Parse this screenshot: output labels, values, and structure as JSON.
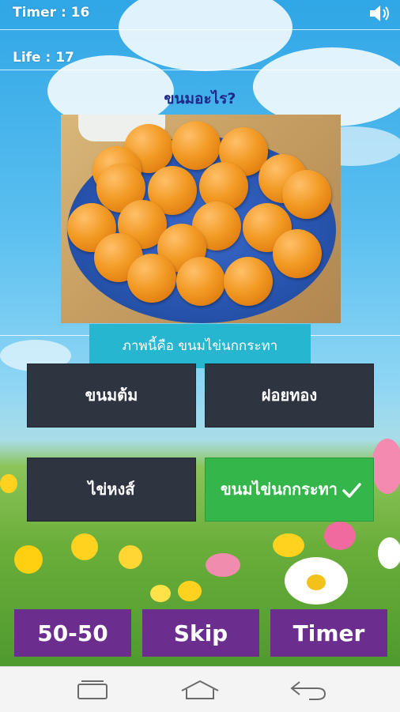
{
  "hud": {
    "timer_text": "Timer  : 16",
    "life_text": "Life : 17",
    "sound_icon": "speaker-icon"
  },
  "question": {
    "text": "ขนมอะไร?"
  },
  "answer_reveal": {
    "text": "ภาพนี้คือ ขนมไข่นกกระทา"
  },
  "options": [
    {
      "label": "ขนมต้ม",
      "state": "normal"
    },
    {
      "label": "ฝอยทอง",
      "state": "normal"
    },
    {
      "label": "ไข่หงส์",
      "state": "normal"
    },
    {
      "label": "ขนมไข่นกกระทา",
      "state": "correct"
    }
  ],
  "helpers": {
    "fifty": "50-50",
    "skip": "Skip",
    "timer": "Timer"
  },
  "colors": {
    "option_bg": "#2e3440",
    "correct_bg": "#35b64a",
    "helper_bg": "#6b2e8f",
    "reveal_bg": "#26b6cf",
    "question_color": "#1e2a8a"
  }
}
